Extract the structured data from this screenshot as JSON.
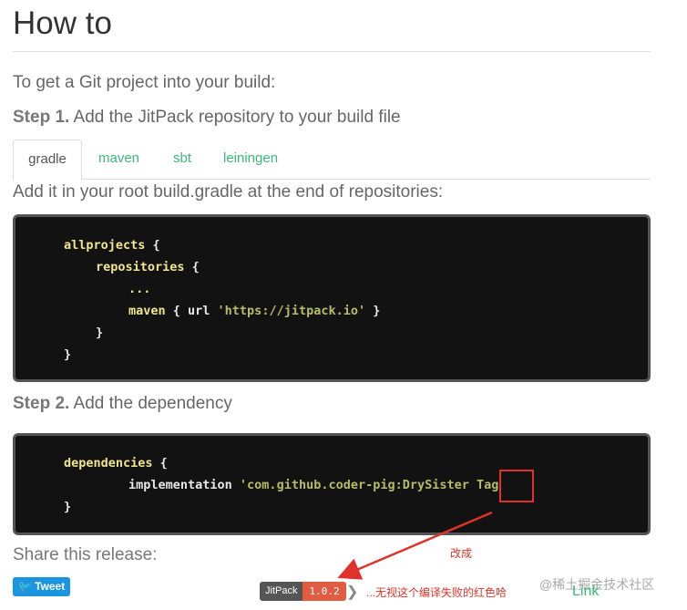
{
  "page": {
    "title": "How to"
  },
  "intro": "To get a Git project into your build:",
  "step1": {
    "label": "Step 1.",
    "text": " Add the JitPack repository to your build file"
  },
  "tabs": [
    "gradle",
    "maven",
    "sbt",
    "leiningen"
  ],
  "add_it": "Add it in your root build.gradle at the end of repositories:",
  "code1": {
    "l1_kw": "allprojects",
    "l1_rest": " {",
    "l2_kw": "repositories",
    "l2_rest": " {",
    "l3": "...",
    "l4_kw": "maven",
    "l4_mid": " { url ",
    "l4_str": "'https://jitpack.io'",
    "l4_end": " }",
    "l5": "}",
    "l6": "}"
  },
  "step2": {
    "label": "Step 2.",
    "text": " Add the dependency"
  },
  "code2": {
    "l1_kw": "dependencies",
    "l1_rest": " {",
    "l2_kw": "implementation",
    "l2_str": " 'com.github.coder-pig:DrySister ",
    "l2_tag": "Tag",
    "l3": "}"
  },
  "share": "Share this release:",
  "tweet_label": "Tweet",
  "badge": {
    "left": "JitPack",
    "right": "1.0.2"
  },
  "annotations": {
    "change": "改成",
    "note": "...无视这个编译失败的红色哈"
  },
  "link_label": "Link",
  "watermark": "@稀土掘金技术社区",
  "colors": {
    "accent": "#3cb878",
    "annotation": "#e0322a",
    "code_bg": "#121212"
  }
}
